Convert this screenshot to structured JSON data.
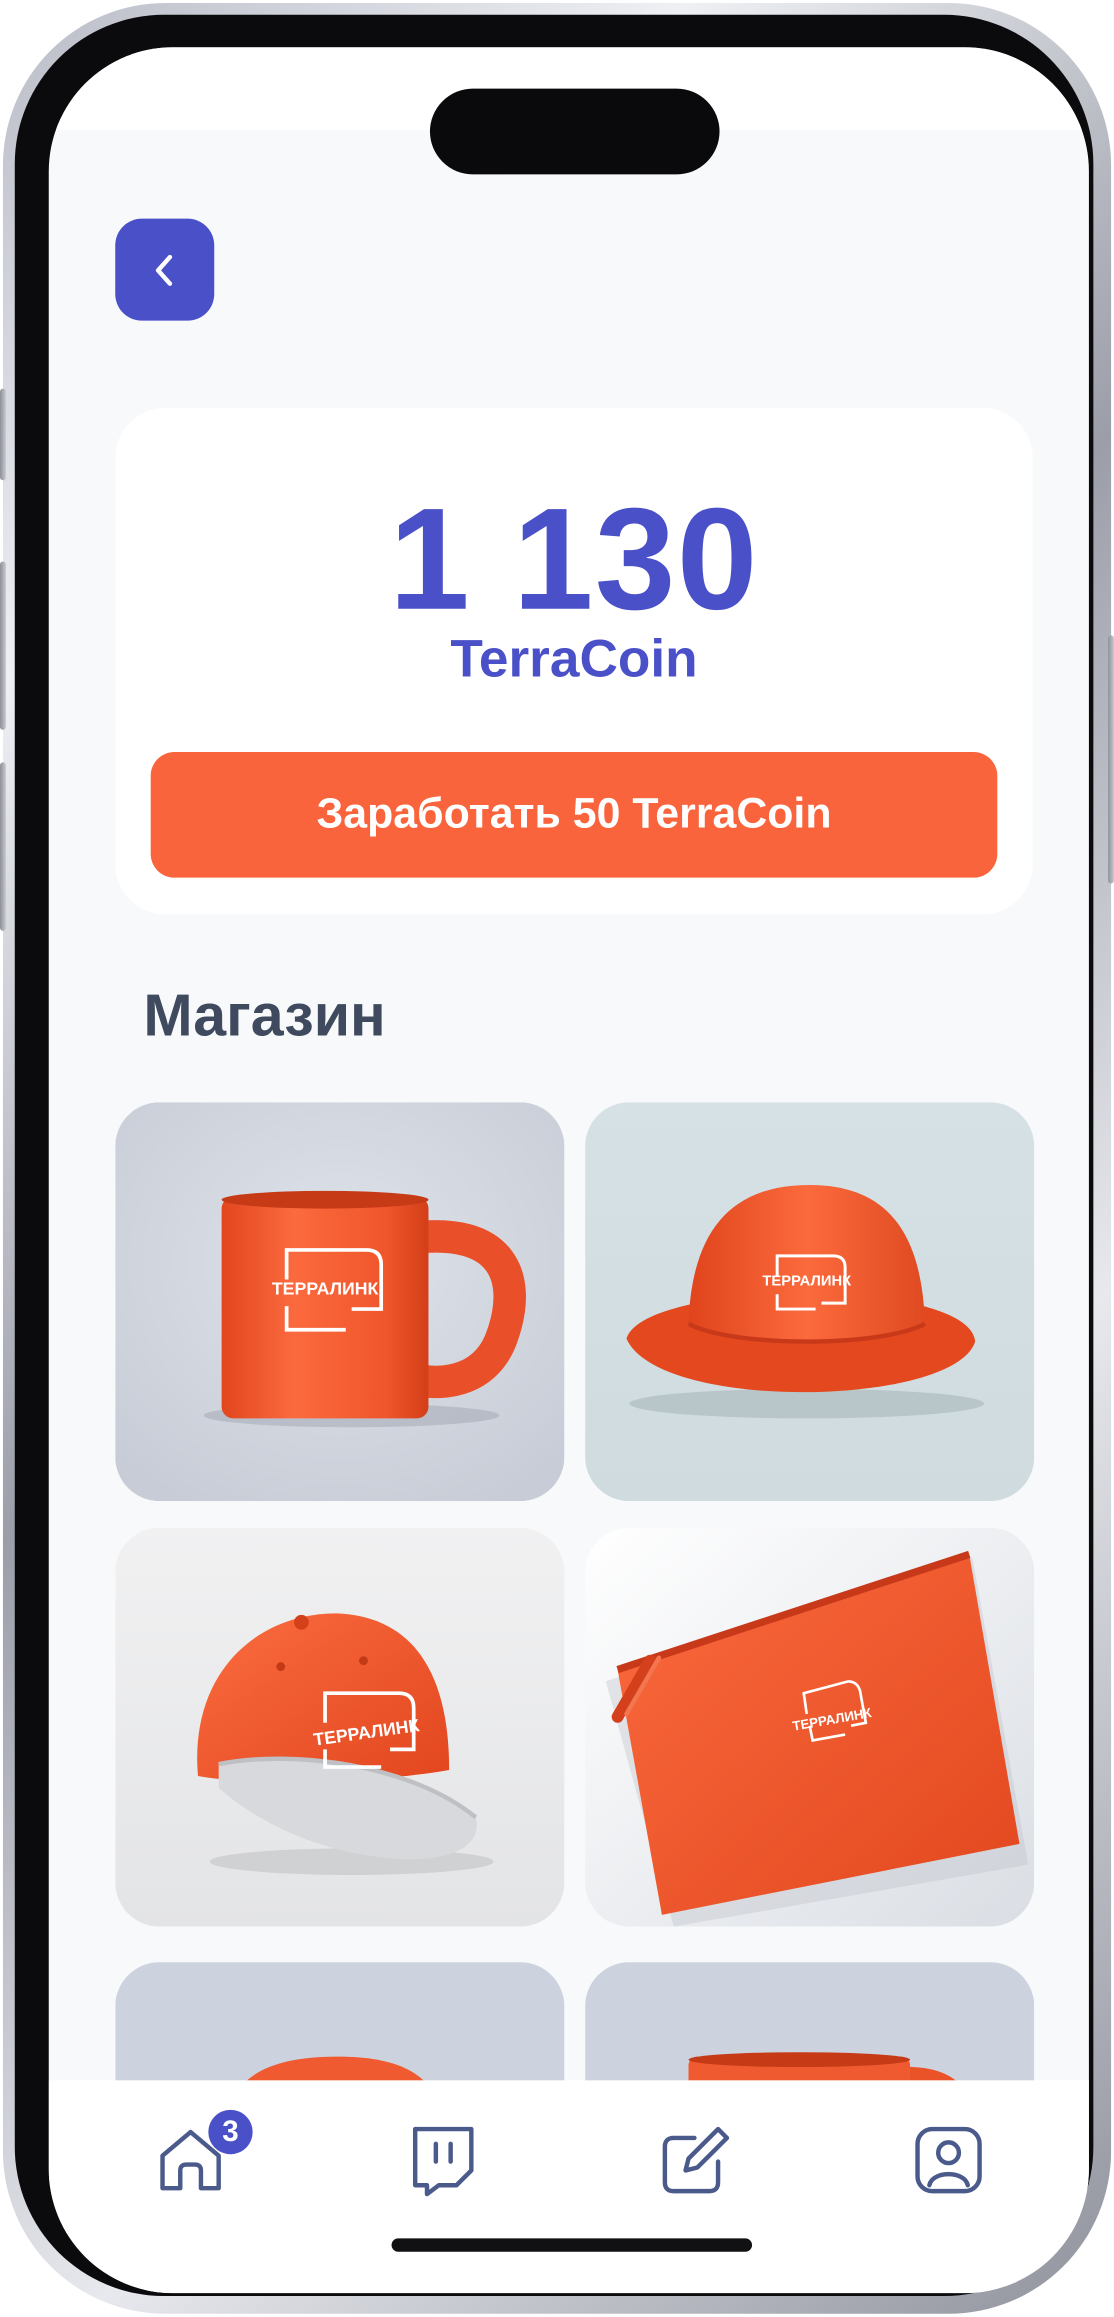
{
  "balance": {
    "amount": "1 130",
    "currency": "TerraCoin",
    "earn_button_label": "Заработать 50 TerraCoin"
  },
  "shop": {
    "title": "Магазин",
    "products": [
      {
        "name": "mug",
        "logo_text": "ТЕРРАЛИНК"
      },
      {
        "name": "bucket-hat",
        "logo_text": "ТЕРРАЛИНК"
      },
      {
        "name": "cap",
        "logo_text": "ТЕРРАЛИНК"
      },
      {
        "name": "pouch",
        "logo_text": "ТЕРРАЛИНК"
      },
      {
        "name": "hat-partial"
      },
      {
        "name": "mug-partial"
      }
    ]
  },
  "tab_bar": {
    "items": [
      {
        "icon": "home-icon",
        "badge": "3"
      },
      {
        "icon": "chat-icon"
      },
      {
        "icon": "edit-icon"
      },
      {
        "icon": "profile-icon"
      }
    ]
  },
  "colors": {
    "accent": "#4a50c8",
    "brand_orange": "#fa643c",
    "background": "#f7f9fb",
    "card": "#ffffff",
    "title_text": "#3f4a5f"
  }
}
